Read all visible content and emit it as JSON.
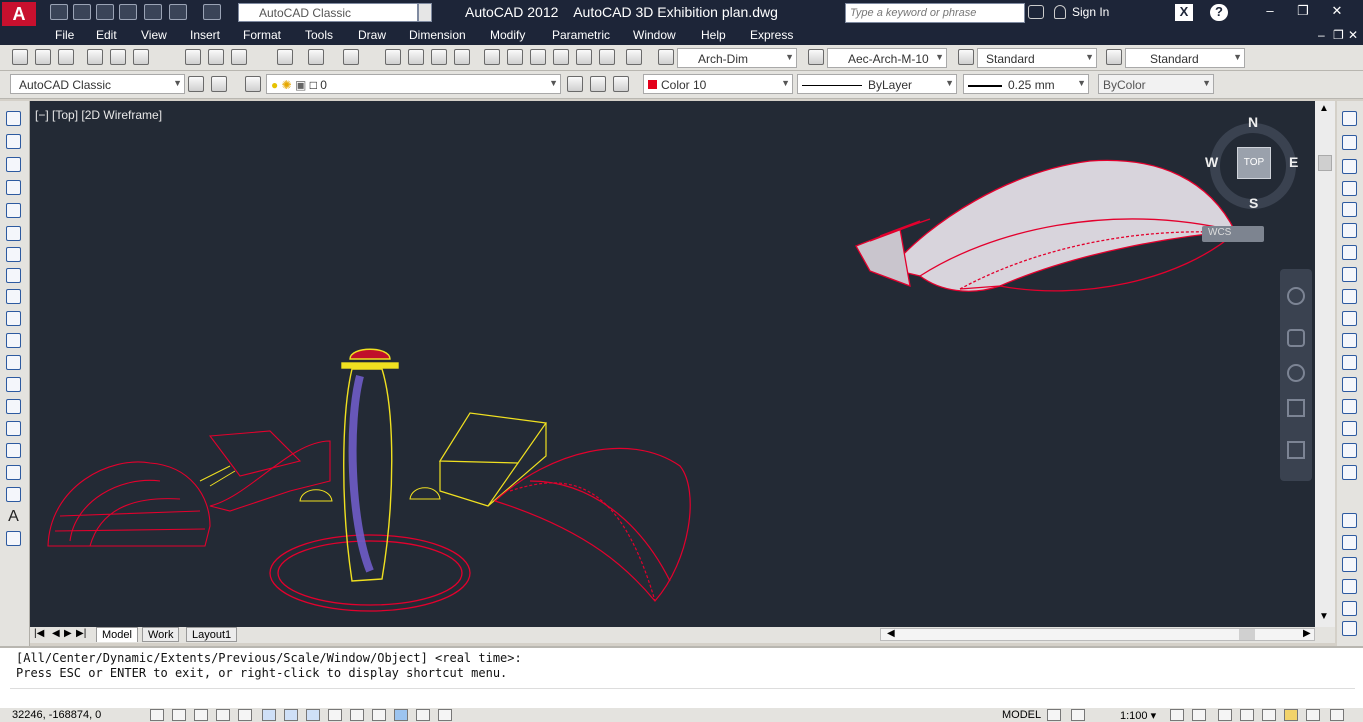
{
  "title": {
    "app": "AutoCAD 2012",
    "document": "AutoCAD 3D Exhibition plan.dwg",
    "workspace": "AutoCAD Classic",
    "search_placeholder": "Type a keyword or phrase",
    "signin": "Sign In"
  },
  "menu": [
    "File",
    "Edit",
    "View",
    "Insert",
    "Format",
    "Tools",
    "Draw",
    "Dimension",
    "Modify",
    "Parametric",
    "Window",
    "Help",
    "Express"
  ],
  "styles": {
    "text_style": "Arch-Dim",
    "dim_style": "Aec-Arch-M-10",
    "table_style": "Standard",
    "mleader_style": "Standard"
  },
  "layers": {
    "workspace2": "AutoCAD Classic",
    "layer_name": "0",
    "color": "Color 10",
    "linetype": "ByLayer",
    "lineweight": "0.25 mm",
    "plotstyle": "ByColor"
  },
  "viewport": {
    "label": "[−] [Top] [2D Wireframe]",
    "compass": {
      "n": "N",
      "s": "S",
      "e": "E",
      "w": "W",
      "top": "TOP"
    },
    "ucs": "WCS"
  },
  "tabs": [
    "Model",
    "Work",
    "Layout1"
  ],
  "command": {
    "line1": "[All/Center/Dynamic/Extents/Previous/Scale/Window/Object] <real time>:",
    "line2": "Press ESC or ENTER to exit, or right-click to display shortcut menu."
  },
  "status": {
    "coords": "32246, -168874, 0",
    "model": "MODEL",
    "scale": "1:100"
  },
  "colors": {
    "accent": "#e3001b",
    "chrome": "#1d2538",
    "canvas": "#232a35",
    "wire_red": "#e3002d",
    "wire_yellow": "#f0e020"
  }
}
